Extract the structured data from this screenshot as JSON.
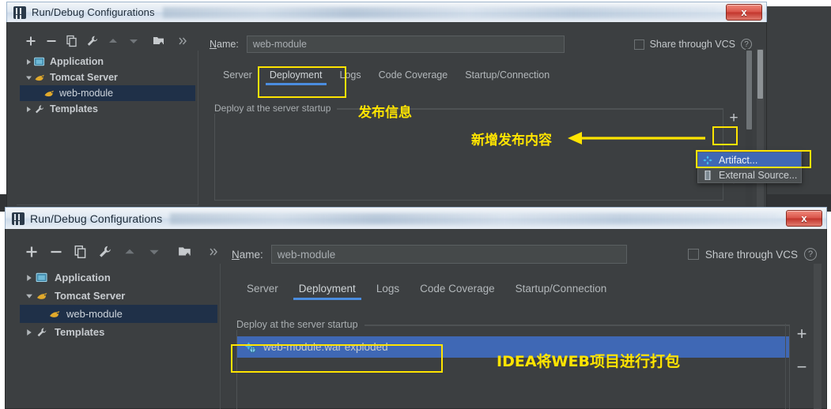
{
  "dialogs": {
    "top": {
      "title": "Run/Debug Configurations",
      "close_label": "x",
      "toolbar_icons": [
        "add-icon",
        "remove-icon",
        "copy-icon",
        "wrench-icon",
        "move-up-icon",
        "move-down-icon",
        "folder-add-icon",
        "more-icon"
      ],
      "tree": [
        {
          "label": "Application",
          "icon": "application-icon",
          "expanded": false,
          "selected": false,
          "child": false
        },
        {
          "label": "Tomcat Server",
          "icon": "tomcat-icon",
          "expanded": true,
          "selected": false,
          "child": false
        },
        {
          "label": "web-module",
          "icon": "tomcat-icon",
          "expanded": null,
          "selected": true,
          "child": true
        },
        {
          "label": "Templates",
          "icon": "wrench-icon",
          "expanded": false,
          "selected": false,
          "child": false
        }
      ],
      "name_label": "Name:",
      "name_value": "web-module",
      "vcs_label": "Share through VCS",
      "vcs_help": "?",
      "tabs": [
        {
          "label": "Server",
          "active": false
        },
        {
          "label": "Deployment",
          "active": true
        },
        {
          "label": "Logs",
          "active": false
        },
        {
          "label": "Code Coverage",
          "active": false
        },
        {
          "label": "Startup/Connection",
          "active": false
        }
      ],
      "group_legend": "Deploy at the server startup",
      "list_items": [],
      "plus_label": "+",
      "popup": {
        "items": [
          {
            "label": "Artifact...",
            "icon": "artifact-icon",
            "selected": true
          },
          {
            "label": "External Source...",
            "icon": "external-source-icon",
            "selected": false
          }
        ]
      },
      "annotations": {
        "deploy_info": "发布信息",
        "add_content": "新增发布内容"
      }
    },
    "bottom": {
      "title": "Run/Debug Configurations",
      "close_label": "x",
      "toolbar_icons": [
        "add-icon",
        "remove-icon",
        "copy-icon",
        "wrench-icon",
        "move-up-icon",
        "move-down-icon",
        "folder-add-icon",
        "more-icon"
      ],
      "tree": [
        {
          "label": "Application",
          "icon": "application-icon",
          "expanded": false,
          "selected": false,
          "child": false
        },
        {
          "label": "Tomcat Server",
          "icon": "tomcat-icon",
          "expanded": true,
          "selected": false,
          "child": false
        },
        {
          "label": "web-module",
          "icon": "tomcat-icon",
          "expanded": null,
          "selected": true,
          "child": true
        },
        {
          "label": "Templates",
          "icon": "wrench-icon",
          "expanded": false,
          "selected": false,
          "child": false
        }
      ],
      "name_label": "Name:",
      "name_value": "web-module",
      "vcs_label": "Share through VCS",
      "vcs_help": "?",
      "tabs": [
        {
          "label": "Server",
          "active": false
        },
        {
          "label": "Deployment",
          "active": true
        },
        {
          "label": "Logs",
          "active": false
        },
        {
          "label": "Code Coverage",
          "active": false
        },
        {
          "label": "Startup/Connection",
          "active": false
        }
      ],
      "group_legend": "Deploy at the server startup",
      "list_items": [
        {
          "label": "web-module:war exploded",
          "icon": "artifact-icon",
          "selected": true
        }
      ],
      "plus_label": "+",
      "minus_label": "−",
      "annotations": {
        "packaging": "IDEA将WEB项目进行打包"
      }
    }
  },
  "colors": {
    "accent_yellow": "#ffe400",
    "selection_blue": "#3f68b5",
    "tab_underline": "#4b8ddf",
    "panel_bg": "#3c3f41",
    "tree_selected": "#1f3048"
  }
}
